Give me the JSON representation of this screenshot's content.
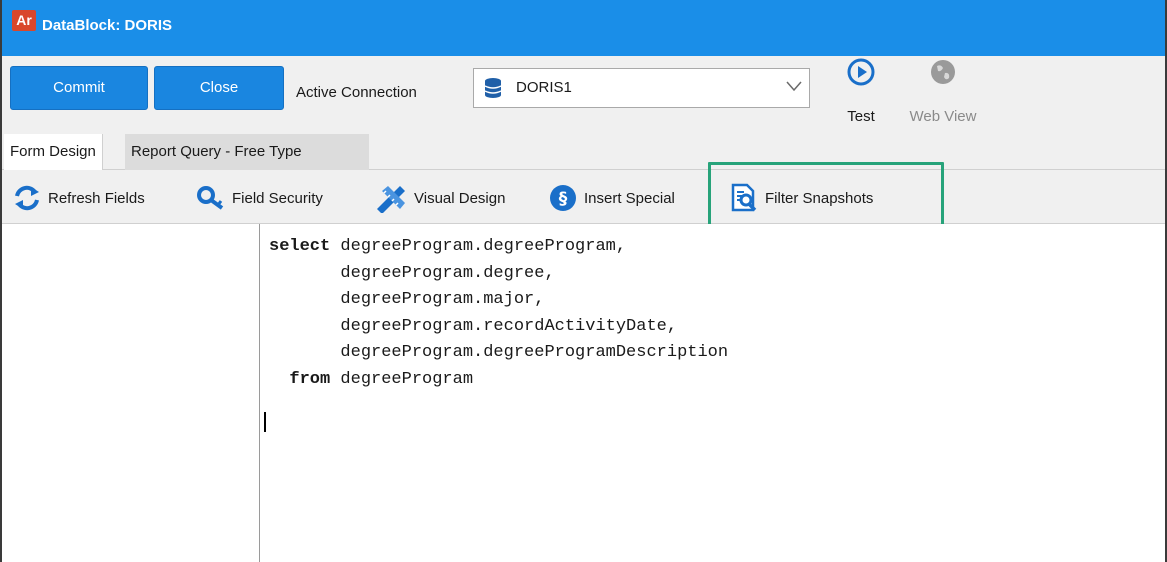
{
  "window": {
    "badge": "Ar",
    "title": "DataBlock: DORIS"
  },
  "toolbar": {
    "commit_label": "Commit",
    "close_label": "Close",
    "active_connection_label": "Active Connection",
    "connection_value": "DORIS1",
    "test_label": "Test",
    "web_view_label": "Web View"
  },
  "tabs": [
    {
      "label": "Form Design",
      "active": false
    },
    {
      "label": "Report Query - Free Type",
      "active": true
    }
  ],
  "subtoolbar": {
    "refresh_fields": "Refresh Fields",
    "field_security": "Field Security",
    "visual_design": "Visual Design",
    "insert_special": "Insert Special",
    "filter_snapshots": "Filter Snapshots"
  },
  "editor": {
    "lines": [
      {
        "kw": "select",
        "text": " degreeProgram.degreeProgram,"
      },
      {
        "kw": "",
        "text": "       degreeProgram.degree,"
      },
      {
        "kw": "",
        "text": "       degreeProgram.major,"
      },
      {
        "kw": "",
        "text": "       degreeProgram.recordActivityDate,"
      },
      {
        "kw": "",
        "text": "       degreeProgram.degreeProgramDescription"
      },
      {
        "kw": "  from",
        "text": " degreeProgram"
      }
    ]
  },
  "colors": {
    "titlebar": "#1a8ee8",
    "button": "#1a86e0",
    "highlight": "#27a37a",
    "badge": "#d9472b"
  }
}
